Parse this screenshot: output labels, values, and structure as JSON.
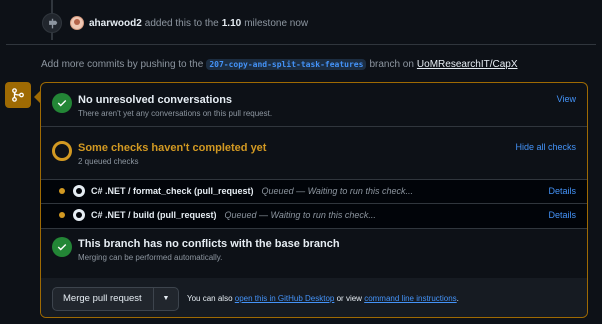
{
  "milestone_event": {
    "user": "aharwood2",
    "text": "added this to the",
    "milestone": "1.10",
    "suffix": "milestone now"
  },
  "commit_hint": {
    "prefix": "Add more commits by pushing to the",
    "branch": "207-copy-and-split-task-features",
    "middle": "branch on",
    "repo": "UoMResearchIT/CapX"
  },
  "conversations": {
    "title": "No unresolved conversations",
    "subtitle": "There aren't yet any conversations on this pull request.",
    "action": "View"
  },
  "checks": {
    "title": "Some checks haven't completed yet",
    "subtitle": "2 queued checks",
    "action": "Hide all checks",
    "items": [
      {
        "name": "C# .NET / format_check (pull_request)",
        "status": "Queued — Waiting to run this check...",
        "details": "Details"
      },
      {
        "name": "C# .NET / build (pull_request)",
        "status": "Queued — Waiting to run this check...",
        "details": "Details"
      }
    ]
  },
  "conflicts": {
    "title": "This branch has no conflicts with the base branch",
    "subtitle": "Merging can be performed automatically."
  },
  "merge": {
    "button_label": "Merge pull request",
    "footer_prefix": "You can also",
    "desktop_link": "open this in GitHub Desktop",
    "footer_middle": "or view",
    "cli_link": "command line instructions",
    "footer_suffix": "."
  },
  "colors": {
    "accent_warning": "#d29922",
    "success": "#238636",
    "link": "#4493f8",
    "background": "#0d1117"
  }
}
